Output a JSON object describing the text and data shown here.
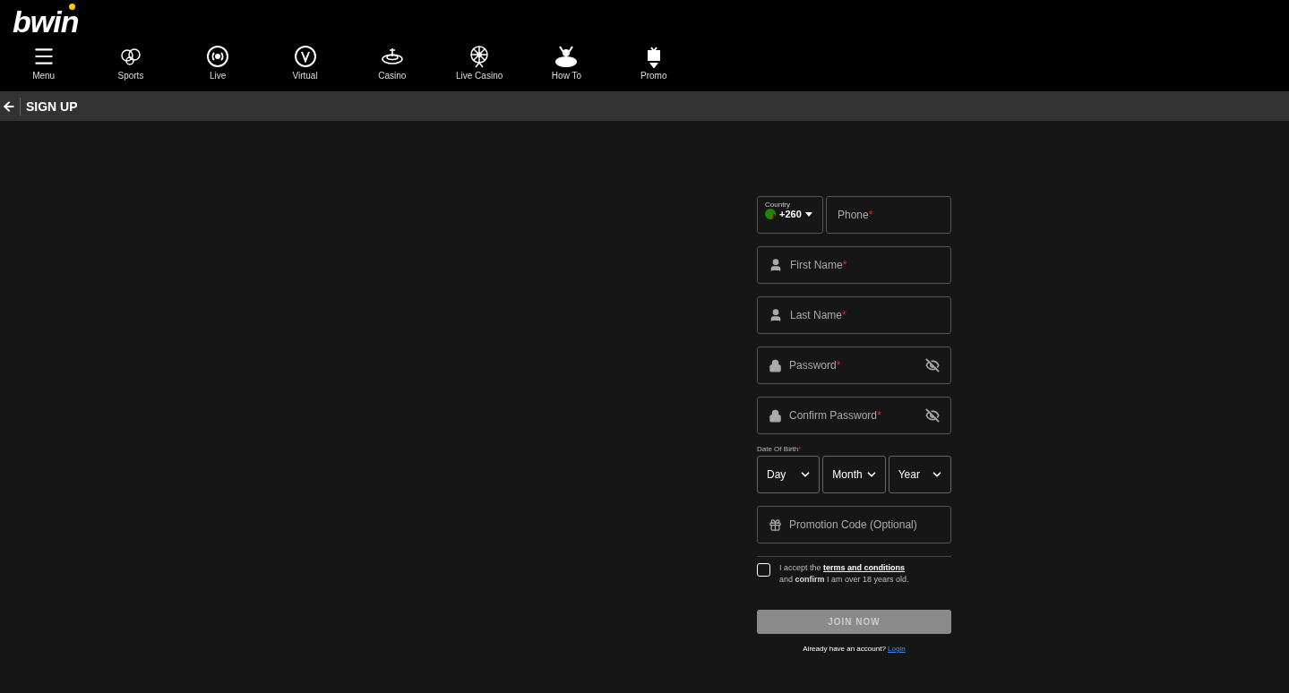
{
  "logo": "bwin",
  "nav": [
    {
      "kind": "menu",
      "label": "Menu"
    },
    {
      "kind": "sports",
      "label": "Sports"
    },
    {
      "kind": "live",
      "label": "Live"
    },
    {
      "kind": "virtual",
      "label": "Virtual"
    },
    {
      "kind": "casino",
      "label": "Casino"
    },
    {
      "kind": "livecasino",
      "label": "Live Casino"
    },
    {
      "kind": "howto",
      "label": "How To"
    },
    {
      "kind": "promo",
      "label": "Promo"
    }
  ],
  "page_title": "SIGN UP",
  "form": {
    "country": {
      "label": "Country",
      "code": "+260"
    },
    "phone": {
      "placeholder": "Phone",
      "mark": "*"
    },
    "fields": [
      {
        "kind": "person",
        "placeholder": "First Name",
        "mark": "*"
      },
      {
        "kind": "person",
        "placeholder": "Last Name",
        "mark": "*"
      },
      {
        "kind": "password",
        "placeholder": "Password",
        "mark": "*"
      },
      {
        "kind": "password",
        "placeholder": "Confirm Password",
        "mark": "*"
      }
    ],
    "dob": {
      "label": "Date Of Birth",
      "mark": "*",
      "selects": [
        "Day",
        "Month",
        "Year"
      ]
    },
    "promo": {
      "placeholder": "Promotion Code (Optional)"
    },
    "terms": {
      "checked": false,
      "before": "I accept the ",
      "link": "terms and conditions",
      "after": "and **confirm** I am over 18 years old."
    },
    "submit": {
      "label": "JOIN NOW",
      "disabled": true
    },
    "login": {
      "text": "Already have an account?",
      "link": "Login"
    }
  }
}
